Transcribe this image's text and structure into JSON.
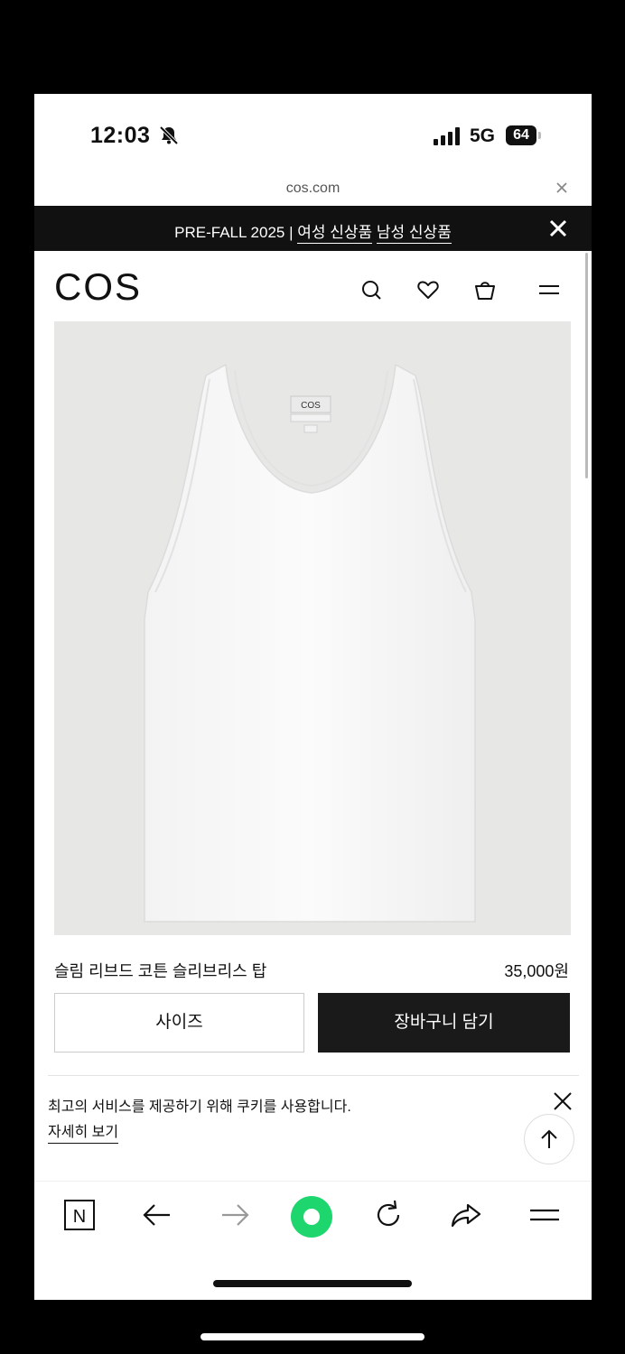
{
  "status_bar": {
    "time": "12:03",
    "network": "5G",
    "battery": "64",
    "icons": [
      "bell-slash-icon",
      "signal-icon"
    ]
  },
  "browser": {
    "url": "cos.com",
    "toolbar_icons": [
      "naver-icon",
      "back-icon",
      "forward-icon",
      "green-dot-icon",
      "reload-icon",
      "share-icon",
      "menu-icon"
    ]
  },
  "promo": {
    "prefix": "PRE-FALL 2025 | ",
    "link_women": "여성 신상품",
    "link_men": "남성 신상품"
  },
  "header": {
    "logo": "COS",
    "icons": [
      "search-icon",
      "heart-icon",
      "bag-icon",
      "menu-icon"
    ]
  },
  "product": {
    "label_text": "COS",
    "name": "슬림 리브드 코튼 슬리브리스 탑",
    "price": "35,000원",
    "size_button": "사이즈",
    "cart_button": "장바구니 담기"
  },
  "cookie": {
    "message": "최고의 서비스를 제공하기 위해 쿠키를 사용합니다.",
    "more_link": "자세히 보기"
  },
  "colors": {
    "accent_green": "#1ed66e",
    "dark": "#1a1a1a",
    "image_bg": "#e7e7e5"
  }
}
